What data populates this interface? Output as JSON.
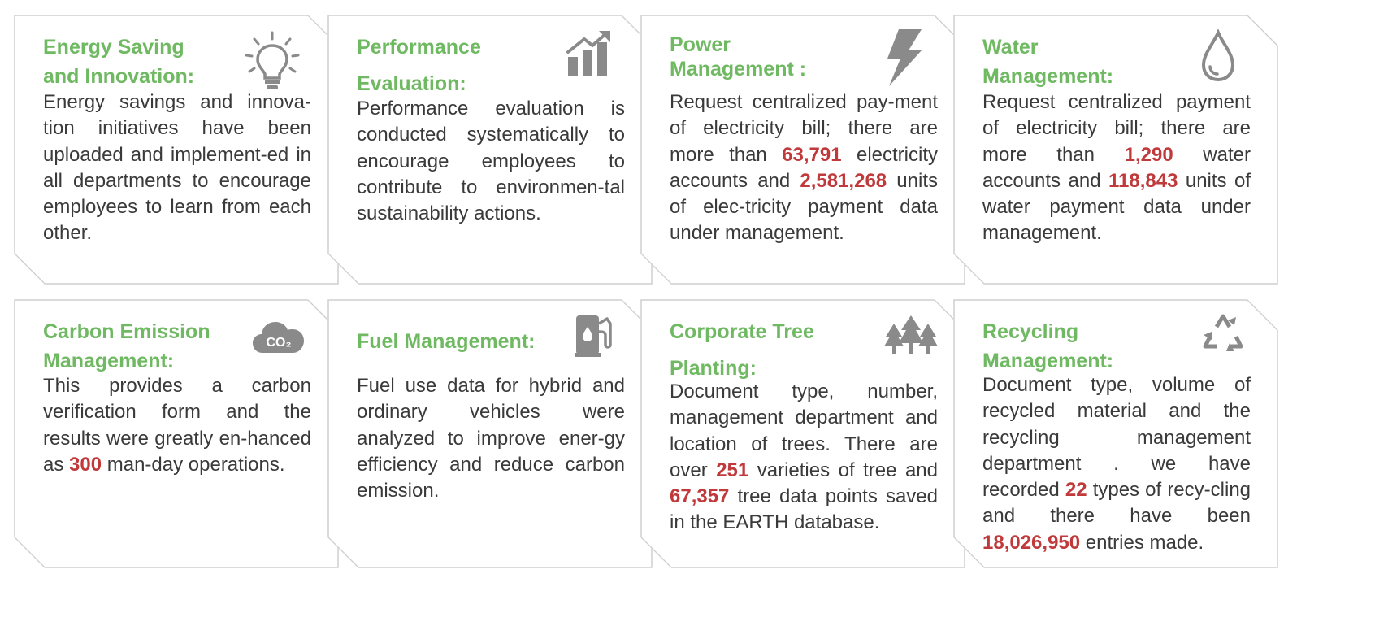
{
  "cards": [
    {
      "title_line1": "Energy Saving",
      "title_line2": "and Innovation:",
      "icon": "lightbulb-icon",
      "body": [
        "Energy savings and innova-tion initiatives have been uploaded and implement-ed in all departments to encourage employees to learn from each other."
      ]
    },
    {
      "title_line1": "Performance",
      "title_line2": "Evaluation:",
      "icon": "growth-chart-icon",
      "body": [
        "Performance evaluation is conducted  systematically to encourage employees to contribute to environmen-tal sustainability actions."
      ]
    },
    {
      "title_line1": "Power",
      "title_line2": "Management :",
      "icon": "lightning-bolt-icon",
      "body": [
        "Request centralized pay-ment of electricity bill; there are more than ",
        "63,791",
        " electricity accounts and ",
        "2,581,268",
        " units of elec-tricity payment data under management."
      ]
    },
    {
      "title_line1": "Water",
      "title_line2": "Management:",
      "icon": "water-drop-icon",
      "body": [
        "Request centralized payment of electricity bill; there are more than ",
        "1,290",
        " water accounts and ",
        "118,843",
        " units of water payment data under management."
      ]
    },
    {
      "title_line1": "Carbon Emission",
      "title_line2": "Management:",
      "icon": "co2-cloud-icon",
      "icon_text": "CO₂",
      "body": [
        "This provides a carbon verification form and the results were greatly en-hanced as ",
        "300",
        " man-day operations."
      ]
    },
    {
      "title_line1": "Fuel Management:",
      "title_line2": "",
      "icon": "fuel-pump-icon",
      "body": [
        "Fuel use data for hybrid and ordinary vehicles were analyzed to improve ener-gy efficiency and reduce carbon emission."
      ]
    },
    {
      "title_line1": "Corporate Tree",
      "title_line2": "Planting:",
      "icon": "trees-icon",
      "body": [
        "Document type, number, management department and location of trees. There are over ",
        "251",
        " varieties of tree and ",
        "67,357",
        " tree data points saved in the EARTH database."
      ]
    },
    {
      "title_line1": "Recycling",
      "title_line2": "Management:",
      "icon": "recycle-icon",
      "body": [
        "Document type, volume of recycled material and the recycling management department . we have recorded ",
        "22",
        " types of recy-cling and there have been ",
        "18,026,950",
        " entries made."
      ]
    }
  ]
}
